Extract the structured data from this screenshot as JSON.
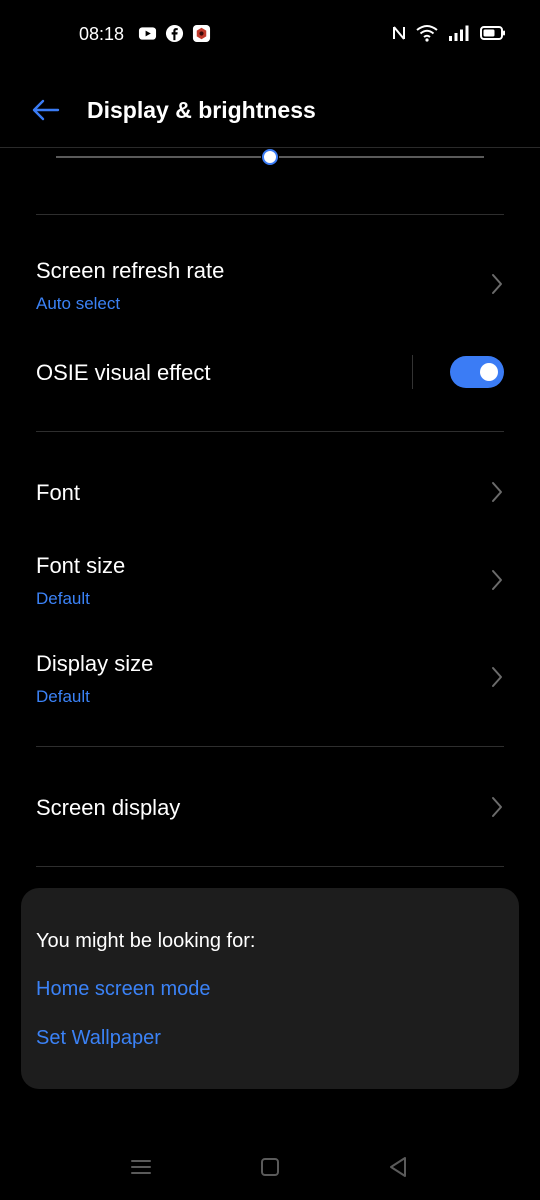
{
  "status_bar": {
    "time": "08:18",
    "left_icons": [
      "youtube-icon",
      "facebook-icon",
      "app-notification-icon"
    ],
    "right_icons": [
      "nfc-icon",
      "wifi-icon",
      "signal-icon",
      "battery-icon"
    ]
  },
  "header": {
    "title": "Display & brightness",
    "back_icon": "back-arrow-icon"
  },
  "brightness": {
    "level_percent": 50
  },
  "rows": {
    "refresh_rate": {
      "title": "Screen refresh rate",
      "subtitle": "Auto select"
    },
    "osie": {
      "title": "OSIE visual effect",
      "toggle_on": true
    },
    "font": {
      "title": "Font"
    },
    "font_size": {
      "title": "Font size",
      "subtitle": "Default"
    },
    "display_size": {
      "title": "Display size",
      "subtitle": "Default"
    },
    "screen_display": {
      "title": "Screen display"
    }
  },
  "suggestions": {
    "heading": "You might be looking for:",
    "links": [
      "Home screen mode",
      "Set Wallpaper"
    ]
  },
  "nav_bar": {
    "icons": [
      "recents-icon",
      "home-icon",
      "back-icon"
    ]
  },
  "colors": {
    "accent": "#3b7cf5",
    "link": "#3b82f6",
    "background": "#000000",
    "card": "#1d1d1d"
  }
}
